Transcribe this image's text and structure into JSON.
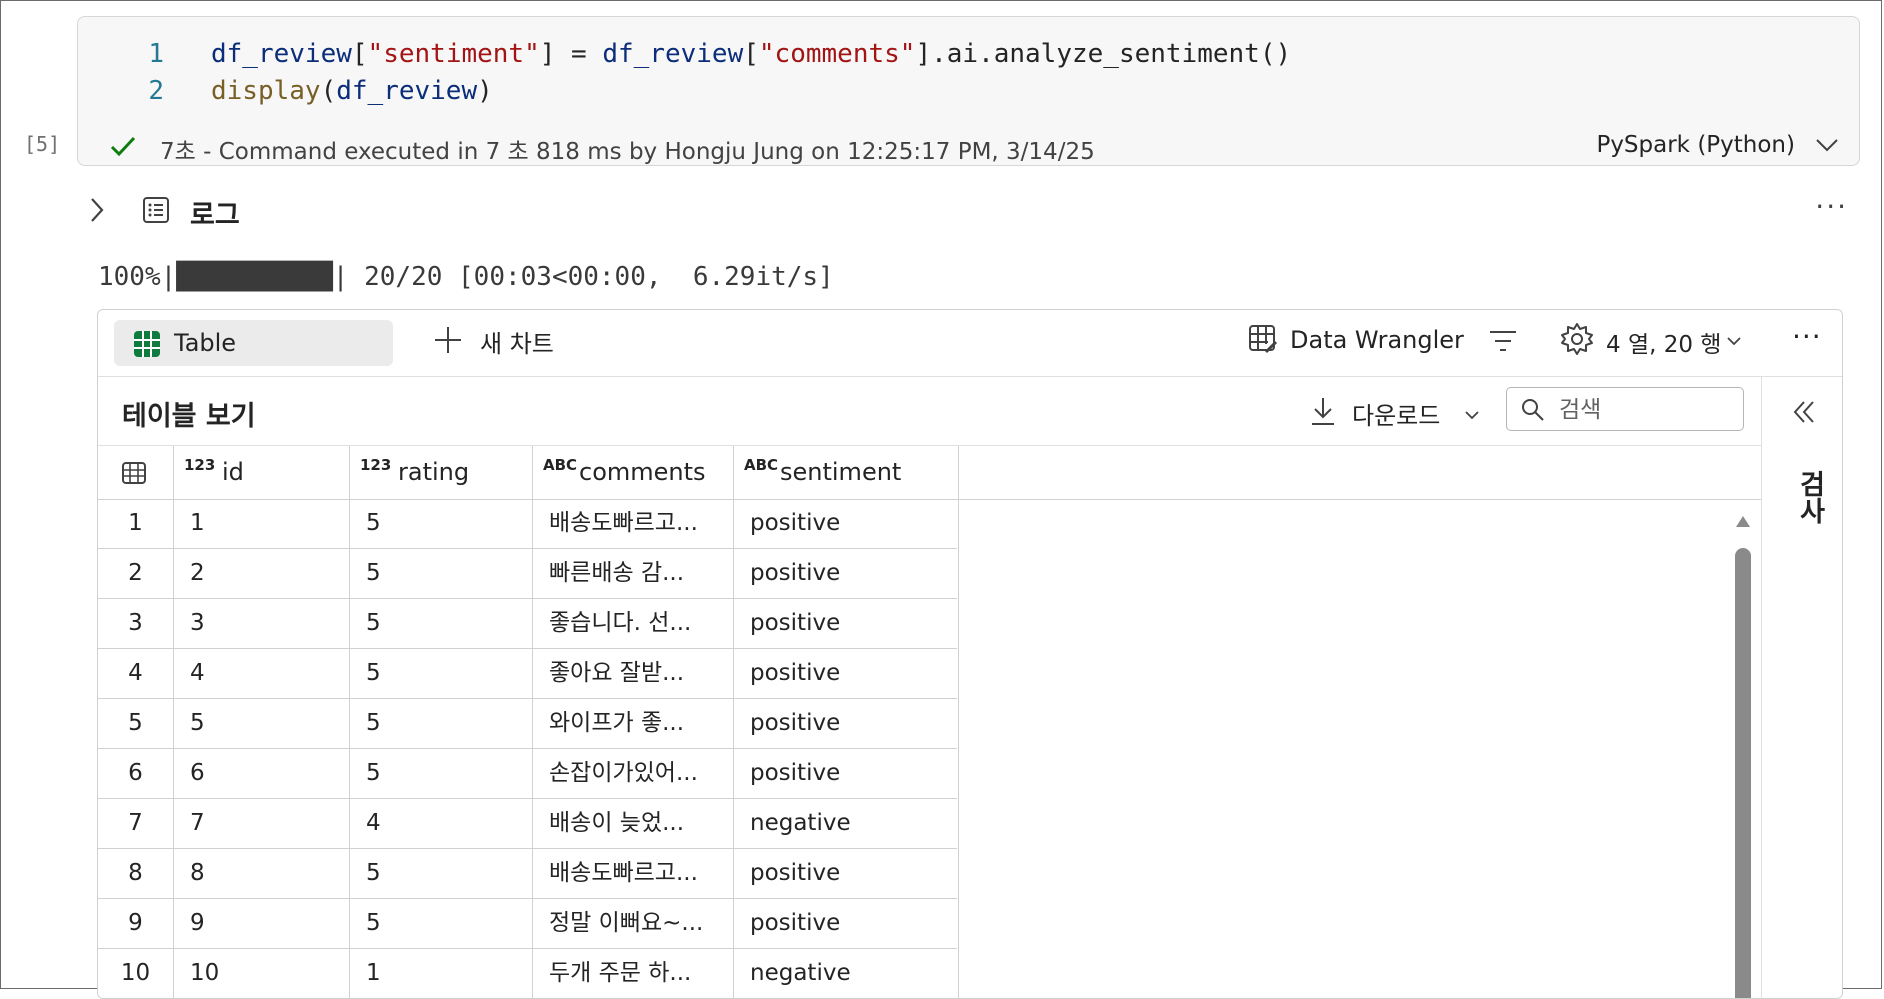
{
  "cell": {
    "exec_count": "[5]",
    "code_lines": [
      {
        "num": "1",
        "tokens": [
          {
            "t": "df_review",
            "k": "var"
          },
          {
            "t": "[",
            "k": "punc"
          },
          {
            "t": "\"sentiment\"",
            "k": "str"
          },
          {
            "t": "] = ",
            "k": "punc"
          },
          {
            "t": "df_review",
            "k": "var"
          },
          {
            "t": "[",
            "k": "punc"
          },
          {
            "t": "\"comments\"",
            "k": "str"
          },
          {
            "t": "].ai.analyze_sentiment()",
            "k": "punc"
          }
        ]
      },
      {
        "num": "2",
        "tokens": [
          {
            "t": "display",
            "k": "fn"
          },
          {
            "t": "(",
            "k": "punc"
          },
          {
            "t": "df_review",
            "k": "var"
          },
          {
            "t": ")",
            "k": "punc"
          }
        ]
      }
    ],
    "status_text": "7초 - Command executed in 7 초 818 ms by Hongju Jung on 12:25:17 PM, 3/14/25",
    "language": "PySpark (Python)"
  },
  "log": {
    "label": "로그",
    "more": "···"
  },
  "progress_text": "100%|██████████| 20/20 [00:03<00:00,  6.29it/s]",
  "toolbar": {
    "table_tab": "Table",
    "new_chart": "새 차트",
    "data_wrangler": "Data Wrangler",
    "cols_rows": "4 열, 20 행",
    "more": "···"
  },
  "table_view": {
    "title": "테이블 보기",
    "download": "다운로드",
    "search_placeholder": "검색",
    "side_label": "검사"
  },
  "columns": [
    {
      "type": "123",
      "name": "id"
    },
    {
      "type": "123",
      "name": "rating"
    },
    {
      "type": "ABC",
      "name": "comments"
    },
    {
      "type": "ABC",
      "name": "sentiment"
    }
  ],
  "rows": [
    [
      "1",
      "1",
      "5",
      "배송도빠르고...",
      "positive"
    ],
    [
      "2",
      "2",
      "5",
      "빠른배송 감...",
      "positive"
    ],
    [
      "3",
      "3",
      "5",
      "좋습니다. 선...",
      "positive"
    ],
    [
      "4",
      "4",
      "5",
      "좋아요 잘받...",
      "positive"
    ],
    [
      "5",
      "5",
      "5",
      "와이프가 좋...",
      "positive"
    ],
    [
      "6",
      "6",
      "5",
      "손잡이가있어...",
      "positive"
    ],
    [
      "7",
      "7",
      "4",
      "배송이 늦었...",
      "negative"
    ],
    [
      "8",
      "8",
      "5",
      "배송도빠르고...",
      "positive"
    ],
    [
      "9",
      "9",
      "5",
      "정말 이뻐요~...",
      "positive"
    ],
    [
      "10",
      "10",
      "1",
      "두개 주문 하...",
      "negative"
    ]
  ],
  "colors": {
    "accent_green": "#0f7b3f",
    "check_green": "#107c10",
    "scroll_thumb": "#8a8a8a"
  }
}
